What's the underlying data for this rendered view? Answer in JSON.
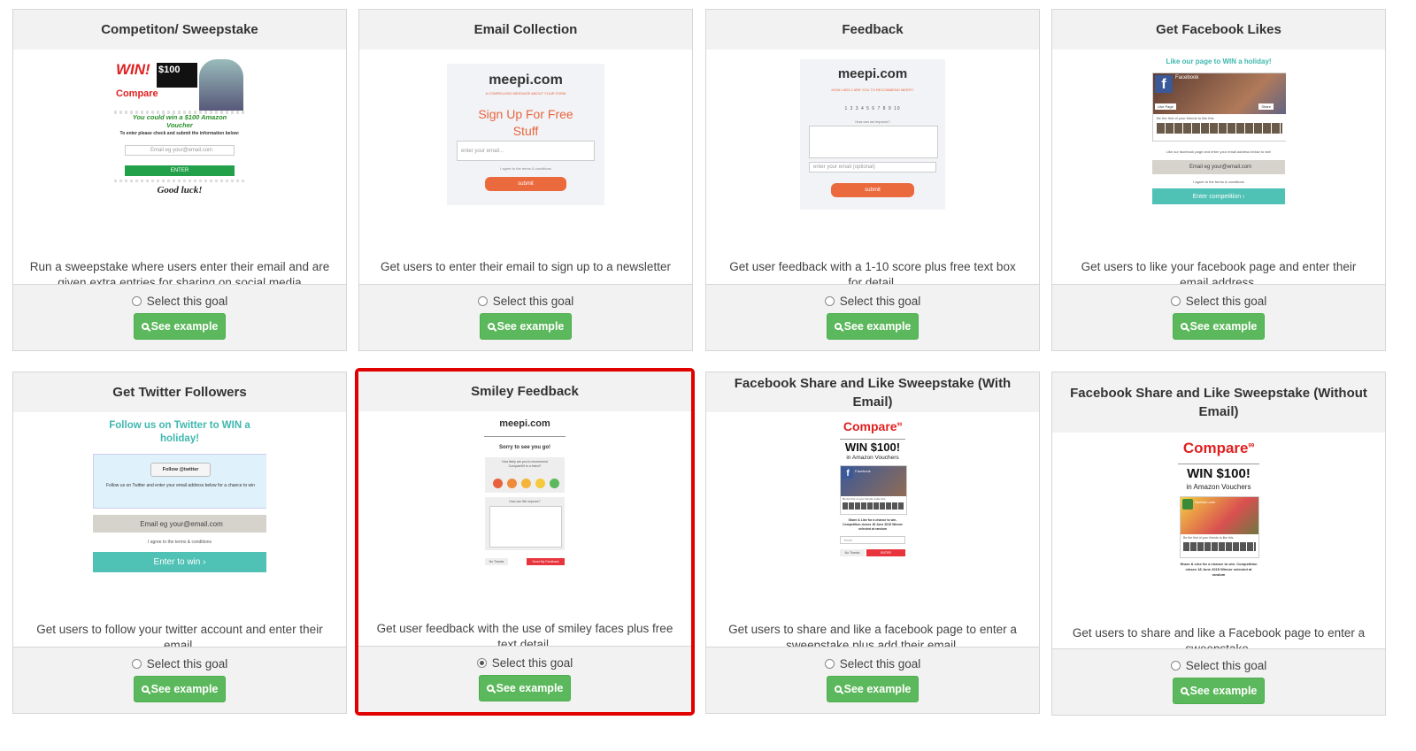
{
  "select_label": "Select this goal",
  "example_label": "See example",
  "cards": [
    {
      "title": "Competiton/ Sweepstake",
      "desc": "Run a sweepstake where users enter their email and are given extra entries for sharing on social media",
      "selected": false,
      "thumb": {
        "win": "WIN!",
        "amount": "$100",
        "brand": "Compare",
        "headline": "You could win a $100 Amazon Voucher",
        "sub": "To enter please check and submit the information below:",
        "email_placeholder": "Email eg your@email.com",
        "enter": "ENTER",
        "luck": "Good luck!"
      }
    },
    {
      "title": "Email Collection",
      "desc": "Get users to enter their email to sign up to a newsletter",
      "selected": false,
      "thumb": {
        "logo": "meepi.com",
        "tagline": "A COMPELLING MESSAGE ABOUT YOUR FORM",
        "headline": "Sign Up For Free Stuff",
        "placeholder": "enter your email...",
        "terms": "I agree to the terms & conditions",
        "submit": "submit"
      }
    },
    {
      "title": "Feedback",
      "desc": "Get user feedback with a 1-10 score plus free text box for detail.",
      "selected": false,
      "thumb": {
        "logo": "meepi.com",
        "question": "HOW LIKELY ARE YOU TO RECOMMEND MEEPI?",
        "scale": "1 2 3 4 5 6 7 8 9 10",
        "improve": "How can we improve?",
        "placeholder": "enter your email (optional)",
        "submit": "submit"
      }
    },
    {
      "title": "Get Facebook Likes",
      "desc": "Get users to like your facebook page and enter their email address.",
      "selected": false,
      "thumb": {
        "headline": "Like our page to WIN a holiday!",
        "fb": "Facebook",
        "like_page": "Like Page",
        "share": "Share",
        "friends": "Be the first of your friends to like this",
        "instruction": "Like our facebook page and enter your email address below to win!",
        "email_placeholder": "Email eg your@email.com",
        "terms": "I agree to the terms & conditions",
        "cta": "Enter competition ›"
      }
    },
    {
      "title": "Get Twitter Followers",
      "desc": "Get users to follow your twitter account and enter their email.",
      "selected": false,
      "thumb": {
        "headline": "Follow us on Twitter to WIN a holiday!",
        "follow": "Follow @twitter",
        "instruction": "Follow us on Twitter and enter your email address below for a chance to win",
        "email_placeholder": "Email eg your@email.com",
        "terms": "I agree to the terms & conditions",
        "cta": "Enter to win ›"
      }
    },
    {
      "title": "Smiley Feedback",
      "desc": "Get user feedback with the use of smiley faces plus free text detail.",
      "selected": true,
      "thumb": {
        "logo": "meepi.com",
        "sorry": "Sorry to see you go!",
        "question": "How likely are you to recommend Compare99 to a friend?",
        "improve": "How can We improve?",
        "no_thanks": "No Thanks",
        "send": "Send My Feedback"
      }
    },
    {
      "title": "Facebook Share and Like Sweepstake (With Email)",
      "desc": "Get users to share and like a facebook page to enter a sweepstake plus add their email.",
      "selected": false,
      "thumb": {
        "brand": "Compare",
        "brand_sup": "99",
        "win": "WIN $100!",
        "sub": "in Amazon Vouchers",
        "fb": "Facebook",
        "friends": "Be the first of your friends to like this",
        "share_text": "Share & Like for a chance to win. Competition closes 18 June 2015 Winner selected at random",
        "email": "Email",
        "no_thanks": "No Thanks",
        "enter": "ENTER"
      }
    },
    {
      "title": "Facebook Share and Like Sweepstake (Without Email)",
      "desc": "Get users to share and like a Facebook page to enter a sweepstake.",
      "selected": false,
      "thumb": {
        "brand": "Compare",
        "brand_sup": "99",
        "win": "WIN $100!",
        "sub": "in Amazon Vouchers",
        "page": "Sprinkle.com",
        "friends": "Be the first of your friends to like this",
        "share_text": "Share & Like for a chance to win. Competition closes 18 June 2015 Winner selected at random"
      }
    }
  ]
}
